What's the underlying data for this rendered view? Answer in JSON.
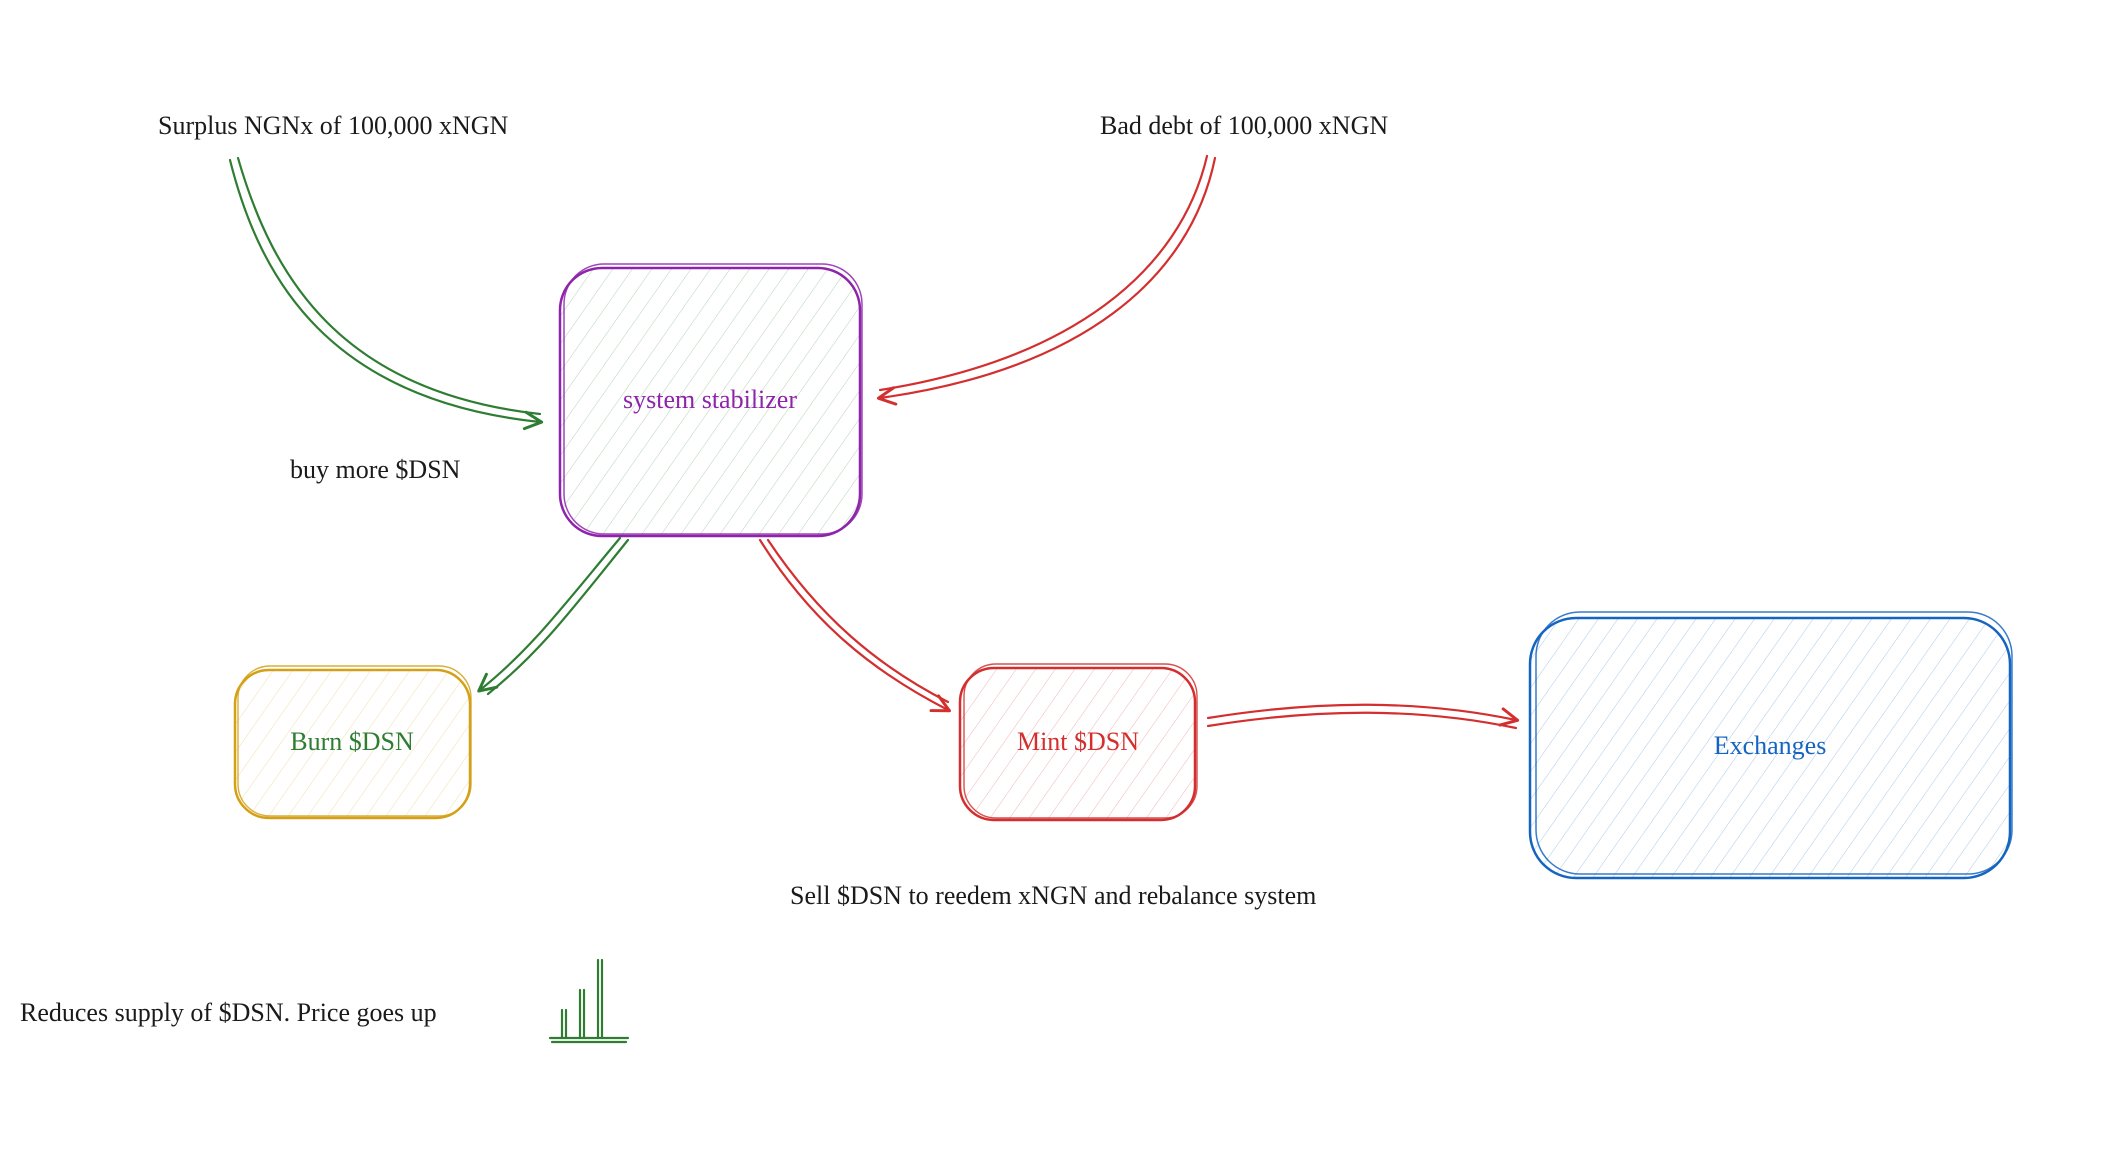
{
  "nodes": {
    "stabilizer": {
      "label": "system stabilizer",
      "stroke": "#8e24aa",
      "hatch": "#2e7d32"
    },
    "burn": {
      "label": "Burn $DSN",
      "stroke": "#d4a017",
      "hatch": "#d4a017",
      "text": "#2e7d32"
    },
    "mint": {
      "label": "Mint $DSN",
      "stroke": "#d32f2f",
      "hatch": "#d32f2f",
      "text": "#d32f2f"
    },
    "exchanges": {
      "label": "Exchanges",
      "stroke": "#1565c0",
      "hatch": "#1565c0",
      "text": "#1565c0"
    }
  },
  "labels": {
    "surplus": "Surplus NGNx of 100,000 xNGN",
    "bad_debt": "Bad debt of 100,000 xNGN",
    "buy_more": "buy more $DSN",
    "sell_dsn": "Sell $DSN to reedem xNGN and rebalance system",
    "reduces": "Reduces supply of $DSN. Price goes up"
  },
  "colors": {
    "green": "#2e7d32",
    "red": "#d32f2f",
    "purple": "#8e24aa",
    "blue": "#1565c0",
    "yellow": "#d4a017",
    "black": "#1a1a1a"
  }
}
